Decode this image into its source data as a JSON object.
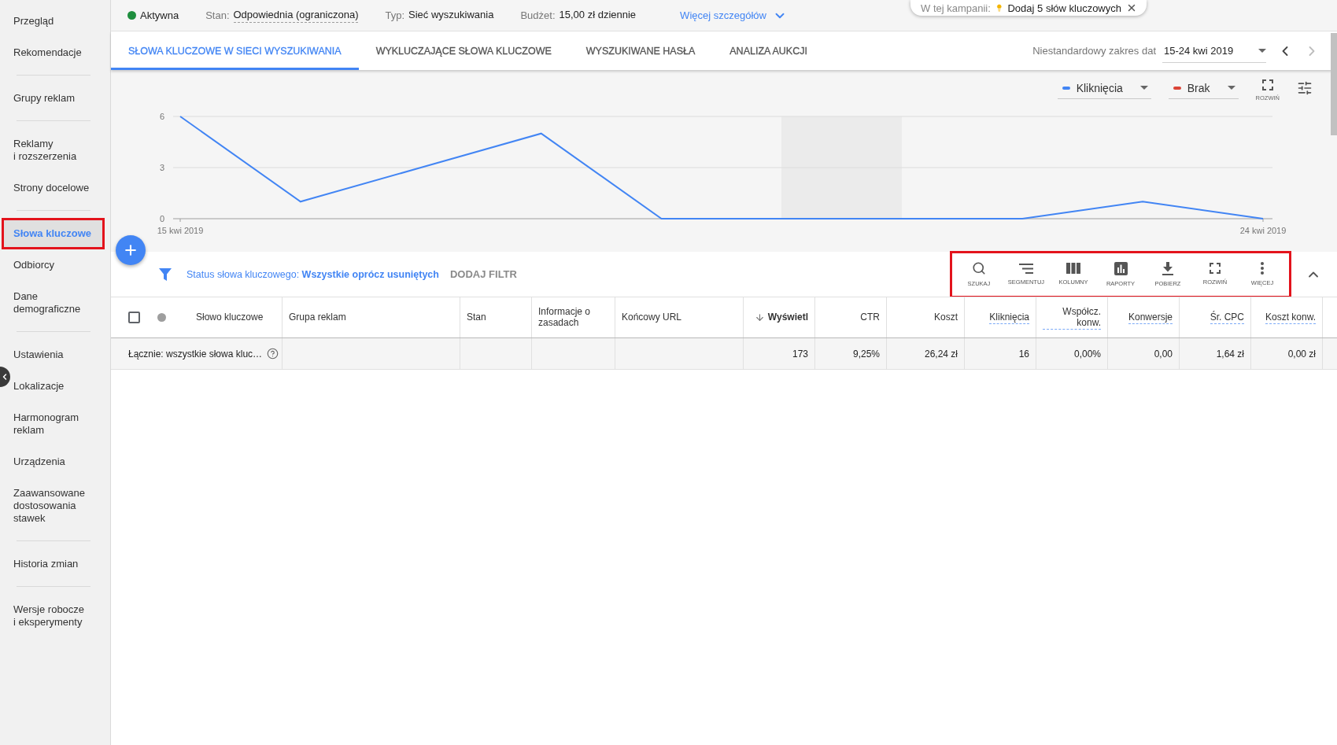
{
  "top_popup": {
    "prefix": "W tej kampanii:",
    "action": "Dodaj 5 słów kluczowych"
  },
  "status_bar": {
    "status": "Aktywna",
    "fields": [
      {
        "label": "Stan:",
        "value": "Odpowiednia (ograniczona)",
        "underlined": true
      },
      {
        "label": "Typ:",
        "value": "Sieć wyszukiwania",
        "underlined": false
      },
      {
        "label": "Budżet:",
        "value": "15,00 zł dziennie",
        "underlined": false
      }
    ],
    "details_link": "Więcej szczegółów"
  },
  "sidebar": {
    "groups": [
      {
        "items": [
          {
            "label": "Przegląd",
            "selected": false,
            "highlighted": false
          },
          {
            "label": "Rekomendacje",
            "selected": false,
            "highlighted": false
          }
        ]
      },
      {
        "items": [
          {
            "label": "Grupy reklam",
            "selected": false,
            "highlighted": false
          }
        ]
      },
      {
        "items": [
          {
            "label": "Reklamy\ni rozszerzenia",
            "selected": false,
            "highlighted": false
          },
          {
            "label": "Strony docelowe",
            "selected": false,
            "highlighted": false
          }
        ]
      },
      {
        "items": [
          {
            "label": "Słowa kluczowe",
            "selected": true,
            "highlighted": true
          },
          {
            "label": "Odbiorcy",
            "selected": false,
            "highlighted": false
          },
          {
            "label": "Dane\ndemograficzne",
            "selected": false,
            "highlighted": false
          }
        ]
      },
      {
        "items": [
          {
            "label": "Ustawienia",
            "selected": false,
            "highlighted": false
          },
          {
            "label": "Lokalizacje",
            "selected": false,
            "highlighted": false
          },
          {
            "label": "Harmonogram\nreklam",
            "selected": false,
            "highlighted": false
          },
          {
            "label": "Urządzenia",
            "selected": false,
            "highlighted": false
          },
          {
            "label": "Zaawansowane\ndostosowania\nstawek",
            "selected": false,
            "highlighted": false
          }
        ]
      },
      {
        "items": [
          {
            "label": "Historia zmian",
            "selected": false,
            "highlighted": false
          }
        ]
      },
      {
        "items": [
          {
            "label": "Wersje robocze\ni eksperymenty",
            "selected": false,
            "highlighted": false
          }
        ]
      }
    ]
  },
  "tabs": [
    {
      "label": "SŁOWA KLUCZOWE W SIECI WYSZUKIWANIA",
      "selected": true
    },
    {
      "label": "WYKLUCZAJĄCE SŁOWA KLUCZOWE",
      "selected": false
    },
    {
      "label": "WYSZUKIWANE HASŁA",
      "selected": false
    },
    {
      "label": "ANALIZA AUKCJI",
      "selected": false
    }
  ],
  "date_range": {
    "label": "Niestandardowy zakres dat",
    "value": "15-24 kwi 2019",
    "prev": {
      "disabled": false
    },
    "next": {
      "disabled": true
    }
  },
  "chart_controls": {
    "compare_metric": {
      "label": "Brak",
      "color": "#db4437"
    },
    "expand": "ROZWIŃ"
  },
  "chart_data": {
    "type": "line",
    "categories": [
      "15 kwi 2019",
      null,
      null,
      null,
      null,
      null,
      null,
      null,
      null,
      "24 kwi 2019"
    ],
    "series": [
      {
        "name": "Kliknięcia",
        "color": "#4285f4",
        "values": [
          6,
          1,
          3,
          5,
          0,
          0,
          0,
          0,
          1,
          0
        ]
      }
    ],
    "ylim": [
      0,
      6
    ],
    "yticks": [
      0,
      3,
      6
    ]
  },
  "filter": {
    "text": "Status słowa kluczowego: **Wszystkie oprócz usuniętych**",
    "add_filter": "DODAJ FILTR"
  },
  "toolbar": {
    "highlighted": true,
    "items": [
      {
        "kind": "search",
        "label": "SZUKAJ"
      },
      {
        "kind": "segment",
        "label": "SEGMENTUJ"
      },
      {
        "kind": "columns",
        "label": "KOLUMNY"
      },
      {
        "kind": "reports",
        "label": "RAPORTY"
      },
      {
        "kind": "download",
        "label": "POBIERZ"
      },
      {
        "kind": "expand",
        "label": "ROZWIŃ"
      },
      {
        "kind": "more",
        "label": "WIĘCEJ"
      }
    ]
  },
  "table": {
    "select_all": {
      "checked": false
    },
    "columns": [
      {
        "label": "Słowo kluczowe",
        "kind": "text",
        "sorted": false,
        "underlined": false
      },
      {
        "label": "Grupa reklam",
        "kind": "text",
        "sorted": false,
        "underlined": false
      },
      {
        "label": "Stan",
        "kind": "text",
        "sorted": false,
        "underlined": false
      },
      {
        "label": "Informacje o zasadach",
        "kind": "text",
        "sorted": false,
        "underlined": false
      },
      {
        "label": "Końcowy URL",
        "kind": "text",
        "sorted": false,
        "underlined": false
      },
      {
        "label": "Wyświetl",
        "kind": "number",
        "sorted": true,
        "underlined": false
      },
      {
        "label": "CTR",
        "kind": "number",
        "sorted": false,
        "underlined": false
      },
      {
        "label": "Koszt",
        "kind": "number",
        "sorted": false,
        "underlined": false
      },
      {
        "label": "Kliknięcia",
        "kind": "number",
        "sorted": false,
        "underlined": true
      },
      {
        "label": "Współcz. konw.",
        "kind": "number",
        "sorted": false,
        "underlined": true
      },
      {
        "label": "Konwersje",
        "kind": "number",
        "sorted": false,
        "underlined": true
      },
      {
        "label": "Śr. CPC",
        "kind": "number",
        "sorted": false,
        "underlined": true
      },
      {
        "label": "Koszt konw.",
        "kind": "number",
        "sorted": false,
        "underlined": true
      }
    ],
    "rows": [
      {
        "kind": "total",
        "cells": [
          "Łącznie: wszystkie słowa kluc…",
          null,
          null,
          null,
          null,
          "173",
          "9,25%",
          "26,24 zł",
          "16",
          "0,00%",
          "0,00",
          "1,64 zł",
          "0,00 zł"
        ]
      }
    ]
  }
}
